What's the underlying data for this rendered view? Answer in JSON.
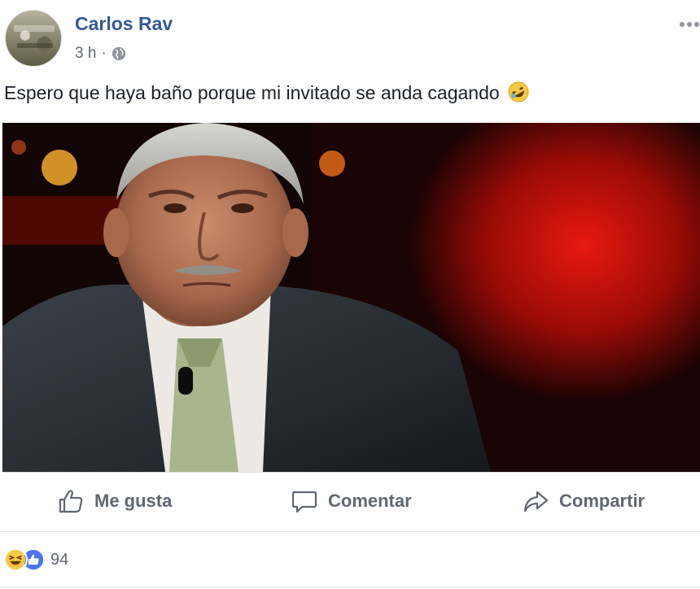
{
  "post": {
    "author": "Carlos Rav",
    "time": "3 h",
    "separator": "·",
    "privacy_icon": "globe-icon",
    "text": "Espero que haya baño porque mi invitado se anda cagando",
    "text_emoji": "rolling-on-floor-laughing-emoji",
    "image_alt_icon": "meme-photo"
  },
  "actions": {
    "like_label": "Me gusta",
    "comment_label": "Comentar",
    "share_label": "Compartir"
  },
  "reactions": {
    "types": [
      "haha",
      "like"
    ],
    "count": "94"
  },
  "colors": {
    "author_link": "#365899",
    "secondary_text": "#606770",
    "like_blue": "#4a76e8",
    "haha_yellow": "#f7c843",
    "divider": "#dddfe2"
  }
}
